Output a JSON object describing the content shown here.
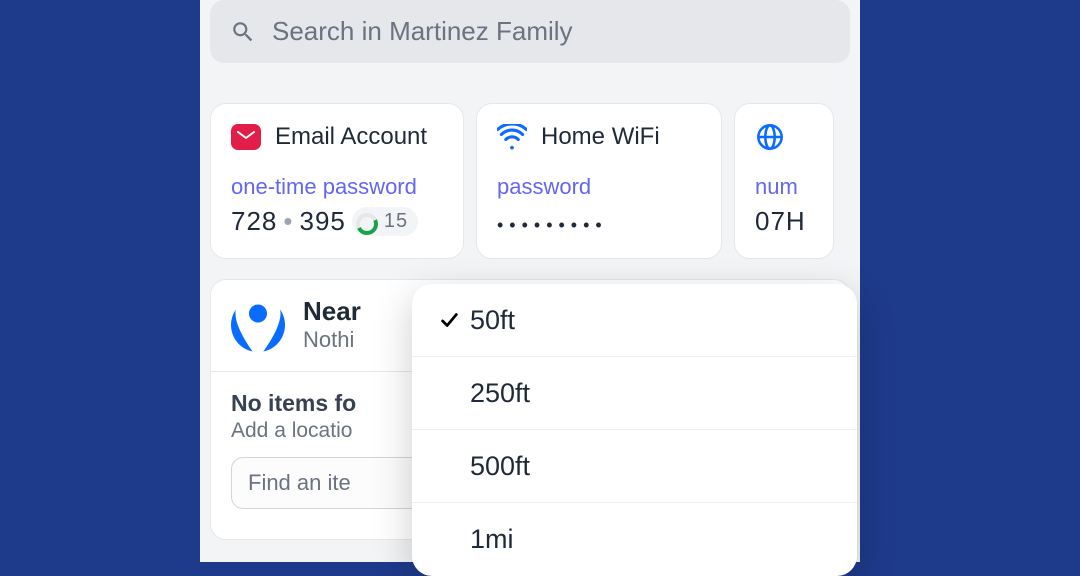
{
  "search": {
    "placeholder": "Search in Martinez Family"
  },
  "cards": [
    {
      "title": "Email Account",
      "label": "one-time password",
      "otp_part1": "728",
      "otp_part2": "395",
      "timer": "15",
      "icon": "email-icon"
    },
    {
      "title": "Home WiFi",
      "label": "password",
      "password_dots": "•••••••••",
      "icon": "wifi-icon"
    },
    {
      "title": "",
      "label": "num",
      "value": "07H",
      "icon": "globe-icon"
    }
  ],
  "nearby": {
    "title": "Near",
    "subtitle": "Nothi",
    "no_items_title": "No items fo",
    "no_items_subtitle": "Add a locatio",
    "find_placeholder": "Find an ite"
  },
  "dropdown": {
    "selected_index": 0,
    "items": [
      {
        "label": "50ft",
        "checked": true
      },
      {
        "label": "250ft",
        "checked": false
      },
      {
        "label": "500ft",
        "checked": false
      },
      {
        "label": "1mi",
        "checked": false
      }
    ]
  }
}
